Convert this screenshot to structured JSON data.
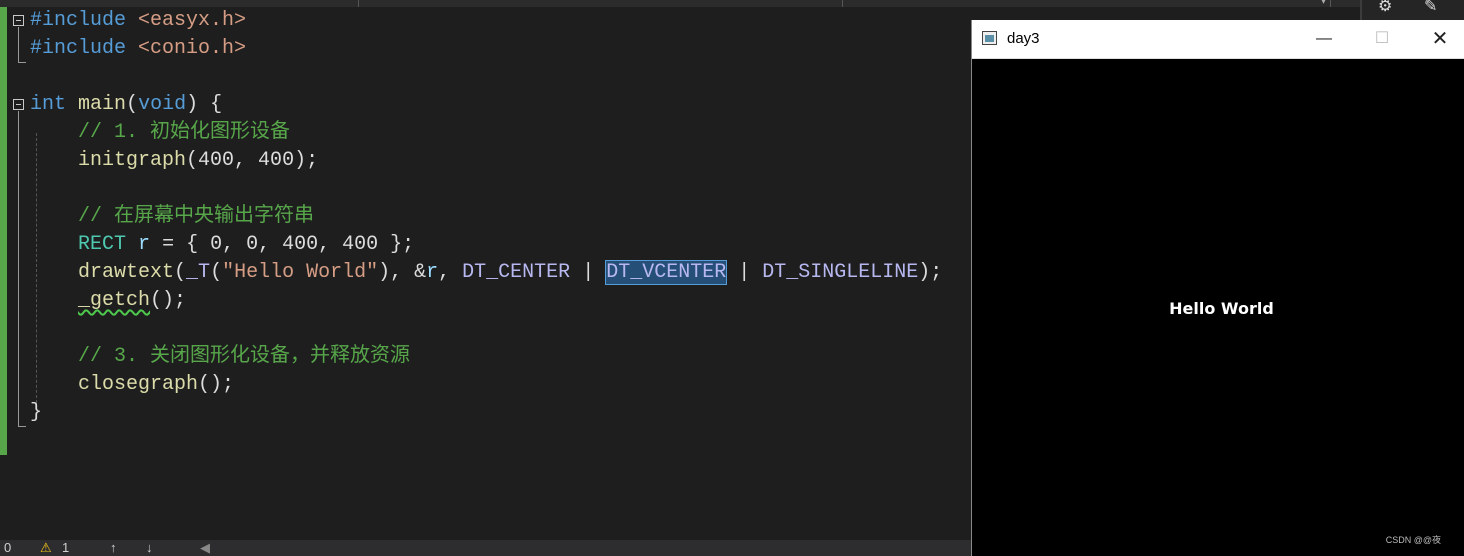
{
  "window": {
    "title": "day3",
    "minimize": "—",
    "maximize": "☐",
    "close": "✕",
    "output_text": "Hello World",
    "watermark": "CSDN @@夜"
  },
  "status_bar": {
    "errors": "0",
    "warning_icon": "⚠",
    "warnings": "1",
    "up_arrow": "↑",
    "down_arrow": "↓",
    "scroll_left": "◀"
  },
  "colors": {
    "editor_bg": "#1e1e1e",
    "keyword": "#569cd6",
    "comment": "#57a64a",
    "string": "#d69d85",
    "selection": "#264f78"
  }
}
